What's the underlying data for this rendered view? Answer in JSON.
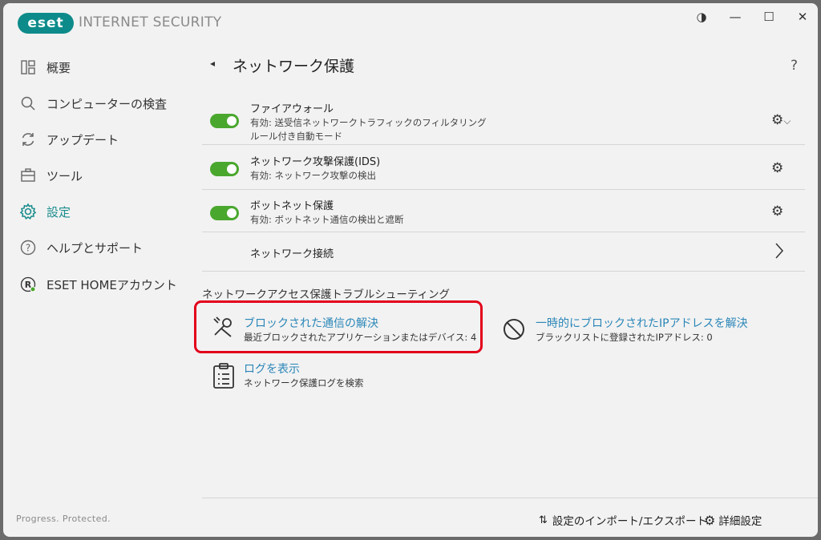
{
  "titlebar": {
    "logo_text": "eset",
    "app_title": "INTERNET SECURITY",
    "controls": {
      "theme": "◑",
      "minimize": "—",
      "maximize": "☐",
      "close": "✕"
    }
  },
  "sidebar": {
    "items": [
      {
        "label": "概要",
        "icon": "overview-icon"
      },
      {
        "label": "コンピューターの検査",
        "icon": "search-icon"
      },
      {
        "label": "アップデート",
        "icon": "refresh-icon"
      },
      {
        "label": "ツール",
        "icon": "briefcase-icon"
      },
      {
        "label": "設定",
        "icon": "gear-icon",
        "active": true
      },
      {
        "label": "ヘルプとサポート",
        "icon": "question-icon"
      },
      {
        "label": "ESET HOMEアカウント",
        "icon": "account-icon"
      }
    ],
    "footer": "Progress. Protected."
  },
  "main": {
    "back": "◂",
    "title": "ネットワーク保護",
    "help": "?",
    "rows": [
      {
        "title": "ファイアウォール",
        "sub1": "有効: 送受信ネットワークトラフィックのフィルタリング",
        "sub2": "ルール付き自動モード"
      },
      {
        "title": "ネットワーク攻撃保護(IDS)",
        "sub1": "有効: ネットワーク攻撃の検出"
      },
      {
        "title": "ボットネット保護",
        "sub1": "有効: ボットネット通信の検出と遮断"
      },
      {
        "title": "ネットワーク接続"
      }
    ],
    "section_title": "ネットワークアクセス保護トラブルシューティング",
    "cards": [
      {
        "title": "ブロックされた通信の解決",
        "sub": "最近ブロックされたアプリケーションまたはデバイス: 4"
      },
      {
        "title": "一時的にブロックされたIPアドレスを解決",
        "sub": "ブラックリストに登録されたIPアドレス: 0"
      },
      {
        "title": "ログを表示",
        "sub": "ネットワーク保護ログを検索"
      }
    ],
    "footer": {
      "import_export": "設定のインポート/エクスポート",
      "advanced": "詳細設定"
    }
  },
  "colors": {
    "accent": "#1a8c8c",
    "toggle_on": "#4aa72e",
    "link": "#2a86b8",
    "highlight": "#e3001b"
  }
}
